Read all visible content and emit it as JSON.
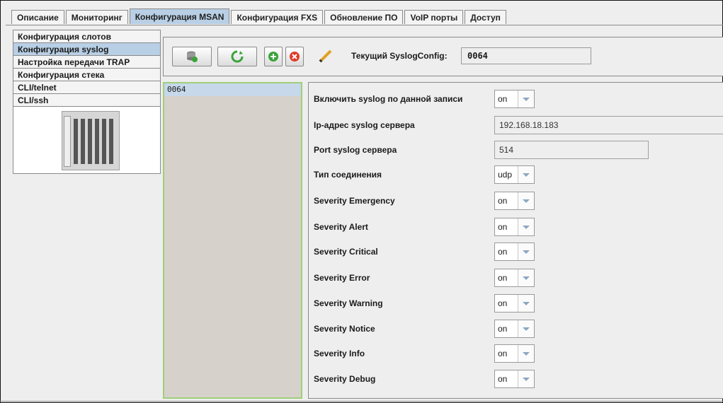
{
  "tabs": [
    {
      "label": "Описание",
      "active": false
    },
    {
      "label": "Мониторинг",
      "active": false
    },
    {
      "label": "Конфигурация MSAN",
      "active": true
    },
    {
      "label": "Конфигурация FXS",
      "active": false
    },
    {
      "label": "Обновление ПО",
      "active": false
    },
    {
      "label": "VoIP порты",
      "active": false
    },
    {
      "label": "Доступ",
      "active": false
    }
  ],
  "sidebar": {
    "items": [
      {
        "label": "Конфигурация слотов",
        "active": false
      },
      {
        "label": "Конфигурация syslog",
        "active": true
      },
      {
        "label": "Настройка передачи TRAP",
        "active": false
      },
      {
        "label": "Конфигурация стека",
        "active": false
      },
      {
        "label": "CLI/telnet",
        "active": false
      },
      {
        "label": "CLI/ssh",
        "active": false
      }
    ],
    "device_image": "msan-chassis-image"
  },
  "toolbar": {
    "buttons": [
      "save-db-icon",
      "refresh-icon",
      "add-icon",
      "delete-icon",
      "edit-pencil-icon"
    ],
    "current_label": "Текущий SyslogConfig:",
    "current_value": "0064"
  },
  "records": [
    "0064"
  ],
  "form": {
    "rows": [
      {
        "label": "Включить syslog по данной записи",
        "type": "combo",
        "value": "on"
      },
      {
        "label": "Ip-адрес syslog сервера",
        "type": "text",
        "value": "192.168.18.183"
      },
      {
        "label": "Port syslog сервера",
        "type": "text",
        "value": "514"
      },
      {
        "label": "Тип соединения",
        "type": "combo",
        "value": "udp"
      },
      {
        "label": "Severity Emergency",
        "type": "combo",
        "value": "on"
      },
      {
        "label": "Severity Alert",
        "type": "combo",
        "value": "on"
      },
      {
        "label": "Severity Critical",
        "type": "combo",
        "value": "on"
      },
      {
        "label": "Severity Error",
        "type": "combo",
        "value": "on"
      },
      {
        "label": "Severity Warning",
        "type": "combo",
        "value": "on"
      },
      {
        "label": "Severity Notice",
        "type": "combo",
        "value": "on"
      },
      {
        "label": "Severity Info",
        "type": "combo",
        "value": "on"
      },
      {
        "label": "Severity Debug",
        "type": "combo",
        "value": "on"
      }
    ]
  },
  "colors": {
    "active_tab": "#b8cfe5",
    "list_border": "#9fcf7a",
    "list_bg": "#d6d2cb"
  }
}
